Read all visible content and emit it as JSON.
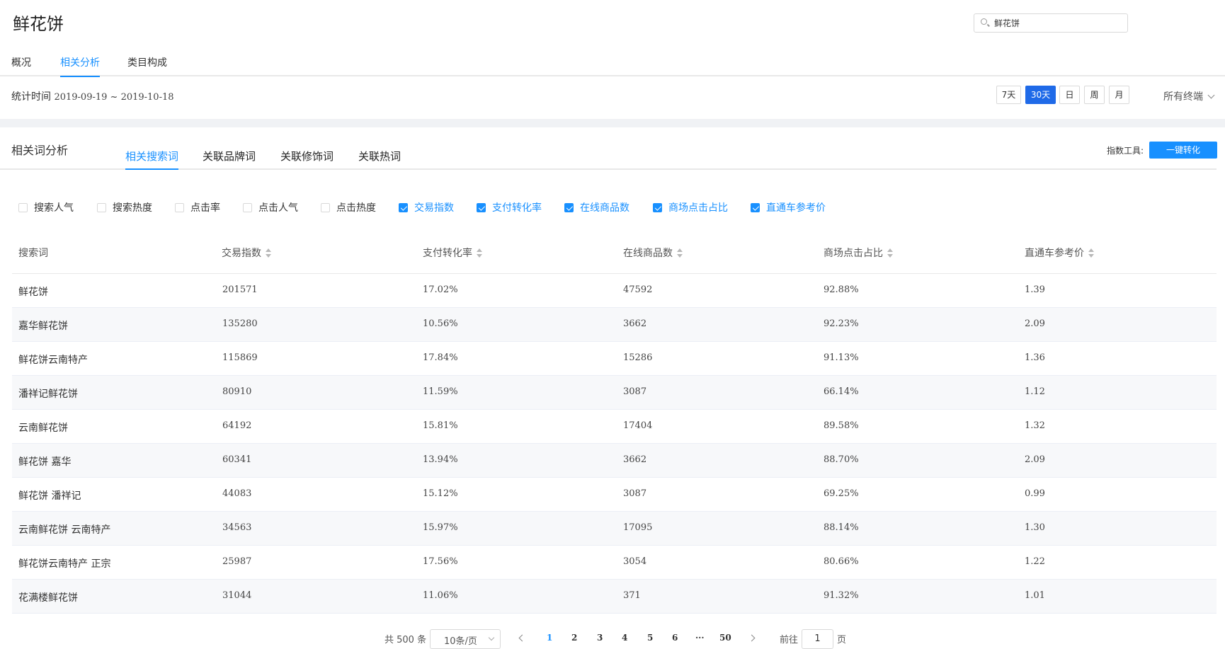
{
  "header": {
    "title": "鲜花饼",
    "search_value": "鲜花饼"
  },
  "tabs": [
    "概况",
    "相关分析",
    "类目构成"
  ],
  "stat": {
    "label": "统计时间",
    "range": "2019-09-19 ~ 2019-10-18"
  },
  "periods": [
    "7天",
    "30天",
    "日",
    "周",
    "月"
  ],
  "terminal": "所有终端",
  "section": {
    "title": "相关词分析",
    "tabs": [
      "相关搜索词",
      "关联品牌词",
      "关联修饰词",
      "关联热词"
    ],
    "tool_label": "指数工具:",
    "tool_button": "一键转化"
  },
  "checkboxes": [
    {
      "label": "搜索人气",
      "checked": false
    },
    {
      "label": "搜索热度",
      "checked": false
    },
    {
      "label": "点击率",
      "checked": false
    },
    {
      "label": "点击人气",
      "checked": false
    },
    {
      "label": "点击热度",
      "checked": false
    },
    {
      "label": "交易指数",
      "checked": true
    },
    {
      "label": "支付转化率",
      "checked": true
    },
    {
      "label": "在线商品数",
      "checked": true
    },
    {
      "label": "商场点击占比",
      "checked": true
    },
    {
      "label": "直通车参考价",
      "checked": true
    }
  ],
  "table": {
    "headers": [
      "搜索词",
      "交易指数",
      "支付转化率",
      "在线商品数",
      "商场点击占比",
      "直通车参考价"
    ],
    "rows": [
      [
        "鲜花饼",
        "201571",
        "17.02%",
        "47592",
        "92.88%",
        "1.39"
      ],
      [
        "嘉华鲜花饼",
        "135280",
        "10.56%",
        "3662",
        "92.23%",
        "2.09"
      ],
      [
        "鲜花饼云南特产",
        "115869",
        "17.84%",
        "15286",
        "91.13%",
        "1.36"
      ],
      [
        "潘祥记鲜花饼",
        "80910",
        "11.59%",
        "3087",
        "66.14%",
        "1.12"
      ],
      [
        "云南鲜花饼",
        "64192",
        "15.81%",
        "17404",
        "89.58%",
        "1.32"
      ],
      [
        "鲜花饼 嘉华",
        "60341",
        "13.94%",
        "3662",
        "88.70%",
        "2.09"
      ],
      [
        "鲜花饼 潘祥记",
        "44083",
        "15.12%",
        "3087",
        "69.25%",
        "0.99"
      ],
      [
        "云南鲜花饼 云南特产",
        "34563",
        "15.97%",
        "17095",
        "88.14%",
        "1.30"
      ],
      [
        "鲜花饼云南特产 正宗",
        "25987",
        "17.56%",
        "3054",
        "80.66%",
        "1.22"
      ],
      [
        "花满楼鲜花饼",
        "31044",
        "11.06%",
        "371",
        "91.32%",
        "1.01"
      ]
    ]
  },
  "pagination": {
    "total": "共 500 条",
    "page_size": "10条/页",
    "pages": [
      "1",
      "2",
      "3",
      "4",
      "5",
      "6",
      "···",
      "50"
    ],
    "goto_label": "前往",
    "goto_value": "1",
    "goto_suffix": "页"
  }
}
